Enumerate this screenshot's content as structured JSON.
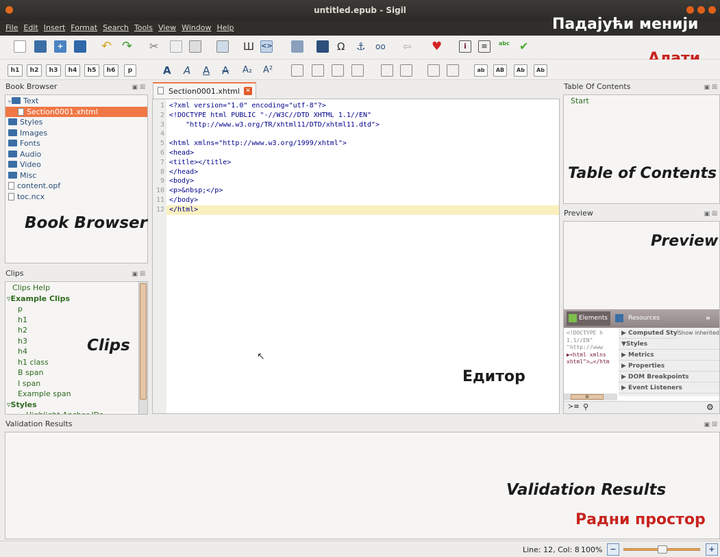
{
  "window": {
    "title": "untitled.epub - Sigil"
  },
  "menu": [
    "File",
    "Edit",
    "Insert",
    "Format",
    "Search",
    "Tools",
    "View",
    "Window",
    "Help"
  ],
  "overlay": {
    "menus": "Падајући менији",
    "tools": "Алати",
    "book_browser": "Book Browser",
    "clips": "Clips",
    "editor": "Едитор",
    "toc": "Table of Contents",
    "preview": "Preview",
    "validation": "Validation Results",
    "workspace": "Радни простор"
  },
  "colors": {
    "overlay_red": "#c8231e",
    "overlay_white": "#ffffff",
    "overlay_dark": "#1c1c1c",
    "accent": "#f07746",
    "current_line": "#faf0be"
  },
  "heading_buttons": [
    "h1",
    "h2",
    "h3",
    "h4",
    "h5",
    "h6",
    "p"
  ],
  "case_buttons": [
    "ab",
    "AB",
    "Ab",
    "Ab"
  ],
  "book_browser": {
    "header": "Book Browser",
    "items": [
      {
        "label": "Text",
        "kind": "folder-open",
        "indent": 0
      },
      {
        "label": "Section0001.xhtml",
        "kind": "file",
        "indent": 1,
        "selected": true
      },
      {
        "label": "Styles",
        "kind": "folder",
        "indent": 0
      },
      {
        "label": "Images",
        "kind": "folder",
        "indent": 0
      },
      {
        "label": "Fonts",
        "kind": "folder",
        "indent": 0
      },
      {
        "label": "Audio",
        "kind": "folder",
        "indent": 0
      },
      {
        "label": "Video",
        "kind": "folder",
        "indent": 0
      },
      {
        "label": "Misc",
        "kind": "folder",
        "indent": 0
      },
      {
        "label": "content.opf",
        "kind": "file",
        "indent": 0
      },
      {
        "label": "toc.ncx",
        "kind": "file",
        "indent": 0
      }
    ]
  },
  "clips": {
    "header": "Clips",
    "items": [
      {
        "label": "Clips Help",
        "bold": false,
        "indent": 0
      },
      {
        "label": "▿Example Clips",
        "bold": true,
        "indent": 0
      },
      {
        "label": "p",
        "bold": false,
        "indent": 1
      },
      {
        "label": "h1",
        "bold": false,
        "indent": 1
      },
      {
        "label": "h2",
        "bold": false,
        "indent": 1
      },
      {
        "label": "h3",
        "bold": false,
        "indent": 1
      },
      {
        "label": "h4",
        "bold": false,
        "indent": 1
      },
      {
        "label": "h1 class",
        "bold": false,
        "indent": 1
      },
      {
        "label": "B span",
        "bold": false,
        "indent": 1
      },
      {
        "label": "I span",
        "bold": false,
        "indent": 1
      },
      {
        "label": "Example span",
        "bold": false,
        "indent": 1
      },
      {
        "label": "▿Styles",
        "bold": true,
        "indent": 0
      },
      {
        "label": "Highlight Anchor IDs",
        "bold": false,
        "indent": 2
      }
    ]
  },
  "editor": {
    "tab": "Section0001.xhtml",
    "current_line": 12,
    "lines": [
      "1",
      "2",
      "3",
      "4",
      "5",
      "6",
      "7",
      "8",
      "9",
      "10",
      "11",
      "12"
    ],
    "code": [
      "<?xml version=\"1.0\" encoding=\"utf-8\"?>",
      "<!DOCTYPE html PUBLIC \"-//W3C//DTD XHTML 1.1//EN\"",
      "    \"http://www.w3.org/TR/xhtml11/DTD/xhtml11.dtd\">",
      "",
      "<html xmlns=\"http://www.w3.org/1999/xhtml\">",
      "<head>",
      "<title></title>",
      "</head>",
      "<body>",
      "<p>&nbsp;</p>",
      "</body>",
      "</html>"
    ]
  },
  "toc": {
    "header": "Table Of Contents",
    "items": [
      "Start"
    ]
  },
  "preview": {
    "header": "Preview"
  },
  "inspector": {
    "tabs": [
      "Elements",
      "Resources"
    ],
    "more": "»",
    "dom": [
      "<!DOCTYPE h",
      "1.1//EN\"",
      "\"http://www",
      "▶<html xmlns",
      "xhtml\">…</htm"
    ],
    "sections": [
      "▶ Computed Style",
      "▼Styles",
      "▶ Metrics",
      "▶ Properties",
      "▶ DOM Breakpoints",
      "▶ Event Listeners"
    ],
    "show_inherited": "Show inherited",
    "scroll_label": "III"
  },
  "validation": {
    "header": "Validation Results"
  },
  "status": {
    "position": "Line: 12, Col: 8",
    "zoom": "100%",
    "zoom_fraction": 0.5,
    "zoom_out": "−",
    "zoom_in": "+"
  }
}
